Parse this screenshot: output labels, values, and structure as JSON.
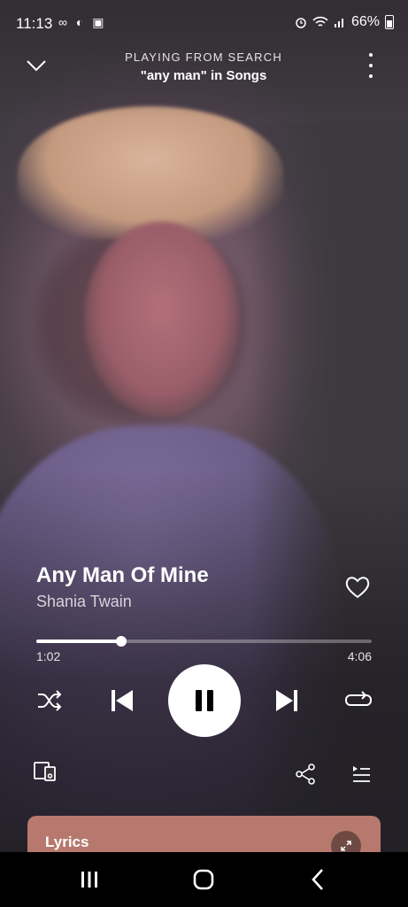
{
  "status_bar": {
    "time": "11:13",
    "left_icons": "∞ ◐ ▣",
    "battery": "66%"
  },
  "header": {
    "context_label": "PLAYING FROM SEARCH",
    "source": "\"any man\" in Songs"
  },
  "track": {
    "title": "Any Man Of Mine",
    "artist": "Shania Twain",
    "elapsed": "1:02",
    "duration": "4:06",
    "progress_fraction": 0.252
  },
  "lyrics": {
    "label": "Lyrics"
  },
  "icons": {
    "collapse": "chevron-down-icon",
    "menu": "more-vertical-icon",
    "like": "heart-icon",
    "shuffle": "shuffle-icon",
    "previous": "skip-previous-icon",
    "play_pause": "pause-icon",
    "next": "skip-next-icon",
    "repeat": "repeat-icon",
    "devices": "devices-icon",
    "share": "share-icon",
    "queue": "queue-icon",
    "expand": "expand-icon"
  },
  "colors": {
    "lyrics_card": "#b7796d",
    "accent": "#ffffff"
  }
}
